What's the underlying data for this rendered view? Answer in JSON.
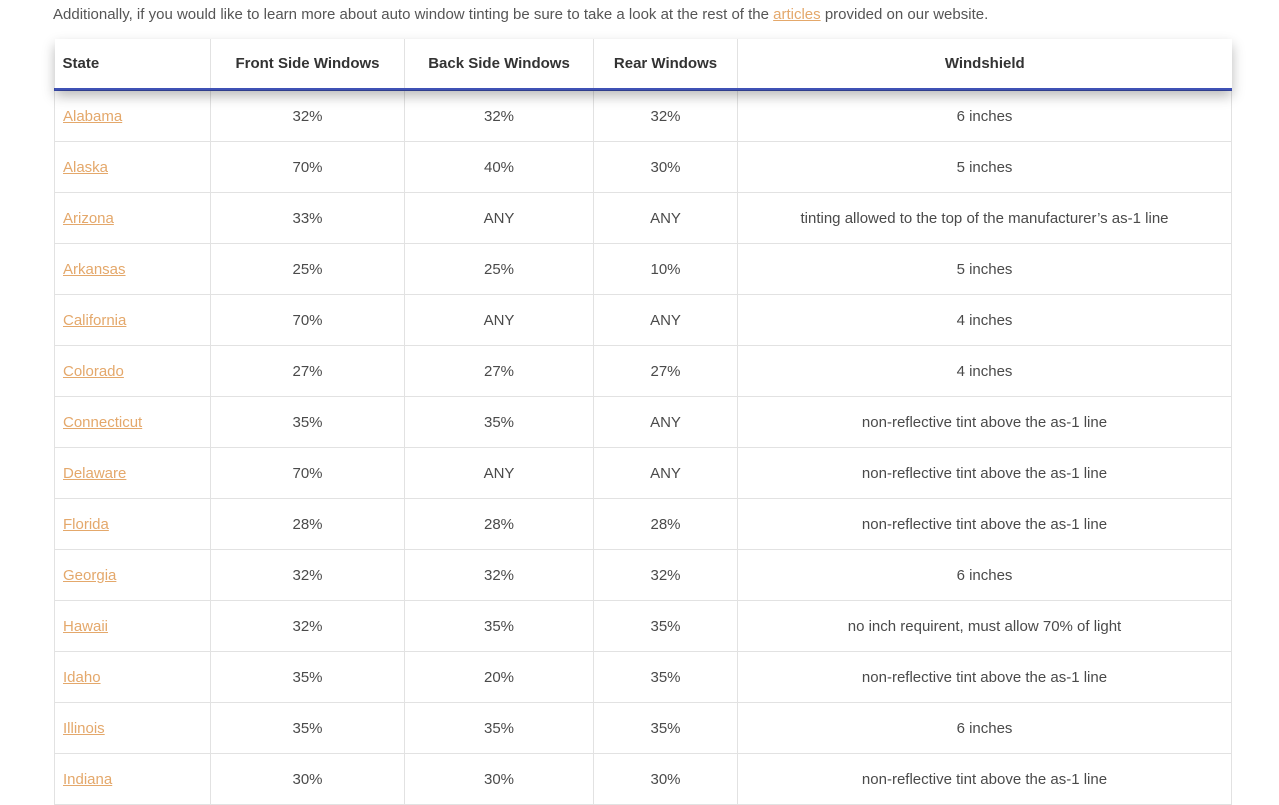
{
  "intro": {
    "text_before": "Additionally, if you would like to learn more about auto window tinting be sure to take a look at the rest of the ",
    "link": "articles",
    "text_after": " provided on our website."
  },
  "colors": {
    "link": "#e4a86b",
    "header_underline": "#3f51b5"
  },
  "table": {
    "headers": [
      "State",
      "Front Side Windows",
      "Back Side Windows",
      "Rear Windows",
      "Windshield"
    ],
    "rows": [
      {
        "state": "Alabama",
        "front": "32%",
        "back": "32%",
        "rear": "32%",
        "windshield": "6 inches"
      },
      {
        "state": "Alaska",
        "front": "70%",
        "back": "40%",
        "rear": "30%",
        "windshield": "5 inches"
      },
      {
        "state": "Arizona",
        "front": "33%",
        "back": "ANY",
        "rear": "ANY",
        "windshield": "tinting allowed to the top of the manufacturer’s as-1 line"
      },
      {
        "state": "Arkansas",
        "front": "25%",
        "back": "25%",
        "rear": "10%",
        "windshield": "5 inches"
      },
      {
        "state": "California",
        "front": "70%",
        "back": "ANY",
        "rear": "ANY",
        "windshield": "4 inches"
      },
      {
        "state": "Colorado",
        "front": "27%",
        "back": "27%",
        "rear": "27%",
        "windshield": "4 inches"
      },
      {
        "state": "Connecticut",
        "front": "35%",
        "back": "35%",
        "rear": "ANY",
        "windshield": "non-reflective tint above the as-1 line"
      },
      {
        "state": "Delaware",
        "front": "70%",
        "back": "ANY",
        "rear": "ANY",
        "windshield": "non-reflective tint above the as-1 line"
      },
      {
        "state": "Florida",
        "front": "28%",
        "back": "28%",
        "rear": "28%",
        "windshield": "non-reflective tint above the as-1 line"
      },
      {
        "state": "Georgia",
        "front": "32%",
        "back": "32%",
        "rear": "32%",
        "windshield": "6 inches"
      },
      {
        "state": "Hawaii",
        "front": "32%",
        "back": "35%",
        "rear": "35%",
        "windshield": "no inch requirent, must allow 70% of light"
      },
      {
        "state": "Idaho",
        "front": "35%",
        "back": "20%",
        "rear": "35%",
        "windshield": "non-reflective tint above the as-1 line"
      },
      {
        "state": "Illinois",
        "front": "35%",
        "back": "35%",
        "rear": "35%",
        "windshield": "6 inches"
      },
      {
        "state": "Indiana",
        "front": "30%",
        "back": "30%",
        "rear": "30%",
        "windshield": "non-reflective tint above the as-1 line"
      }
    ]
  }
}
